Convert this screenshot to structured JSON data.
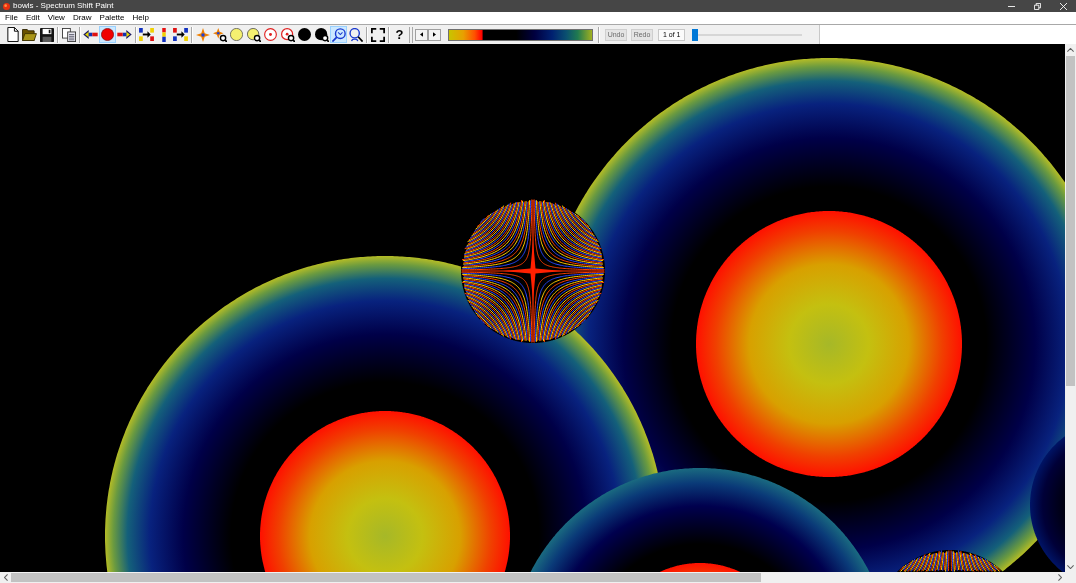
{
  "window": {
    "title": "bowls - Spectrum Shift Paint"
  },
  "menu": [
    "File",
    "Edit",
    "View",
    "Draw",
    "Palette",
    "Help"
  ],
  "toolbar": {
    "groups": [
      [
        {
          "kind": "new",
          "selected": false
        },
        {
          "kind": "open",
          "selected": false
        },
        {
          "kind": "save",
          "selected": false
        }
      ],
      [
        {
          "kind": "copy",
          "selected": false
        }
      ],
      [
        {
          "kind": "prev",
          "selected": false
        },
        {
          "kind": "record",
          "selected": true
        },
        {
          "kind": "next",
          "selected": false
        }
      ],
      [
        {
          "kind": "shift_left",
          "selected": false
        },
        {
          "kind": "spectrum",
          "selected": false
        },
        {
          "kind": "shift_right",
          "selected": false
        }
      ],
      [
        {
          "kind": "cross",
          "selected": false
        },
        {
          "kind": "cross_zoom",
          "selected": false
        },
        {
          "kind": "circle",
          "selected": false
        },
        {
          "kind": "circle_zoom",
          "selected": false
        },
        {
          "kind": "target",
          "selected": false
        },
        {
          "kind": "target_zoom",
          "selected": false
        },
        {
          "kind": "dot",
          "selected": false
        },
        {
          "kind": "dot_zoom",
          "selected": false
        },
        {
          "kind": "zoom",
          "selected": true
        },
        {
          "kind": "zoom_fit",
          "selected": false
        }
      ],
      [
        {
          "kind": "fullscreen",
          "selected": false
        }
      ],
      [
        {
          "kind": "help",
          "label": "?",
          "selected": false
        }
      ]
    ],
    "steppers": [
      {
        "kind": "left"
      },
      {
        "kind": "right"
      }
    ],
    "history": [
      {
        "label": "Undo",
        "disabled": true
      },
      {
        "label": "Redo",
        "disabled": true
      }
    ],
    "frame_counter": "1 of 1",
    "slider": {
      "level": 0
    }
  }
}
